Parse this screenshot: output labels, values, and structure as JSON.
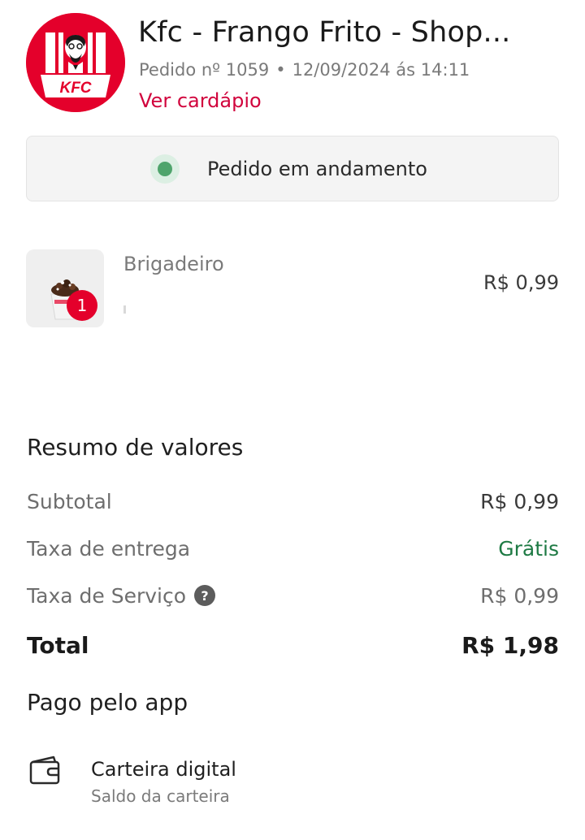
{
  "header": {
    "store_name": "Kfc - Frango Frito - Shop...",
    "order_number": "Pedido nº 1059",
    "order_datetime": "12/09/2024 ás 14:11",
    "menu_link": "Ver cardápio",
    "logo_text": "KFC"
  },
  "status": {
    "text": "Pedido em andamento",
    "color": "#4fa46c"
  },
  "items": [
    {
      "name": "Brigadeiro",
      "quantity": "1",
      "price": "R$ 0,99"
    }
  ],
  "summary": {
    "title": "Resumo de valores",
    "subtotal_label": "Subtotal",
    "subtotal_value": "R$ 0,99",
    "delivery_label": "Taxa de entrega",
    "delivery_value": "Grátis",
    "service_label": "Taxa de Serviço",
    "service_value": "R$ 0,99",
    "help_icon": "?",
    "total_label": "Total",
    "total_value": "R$ 1,98"
  },
  "payment": {
    "title": "Pago pelo app",
    "method": "Carteira digital",
    "detail": "Saldo da carteira"
  },
  "colors": {
    "brand_red": "#e4002b",
    "link_red": "#d1043d",
    "free_green": "#1e7a44"
  }
}
